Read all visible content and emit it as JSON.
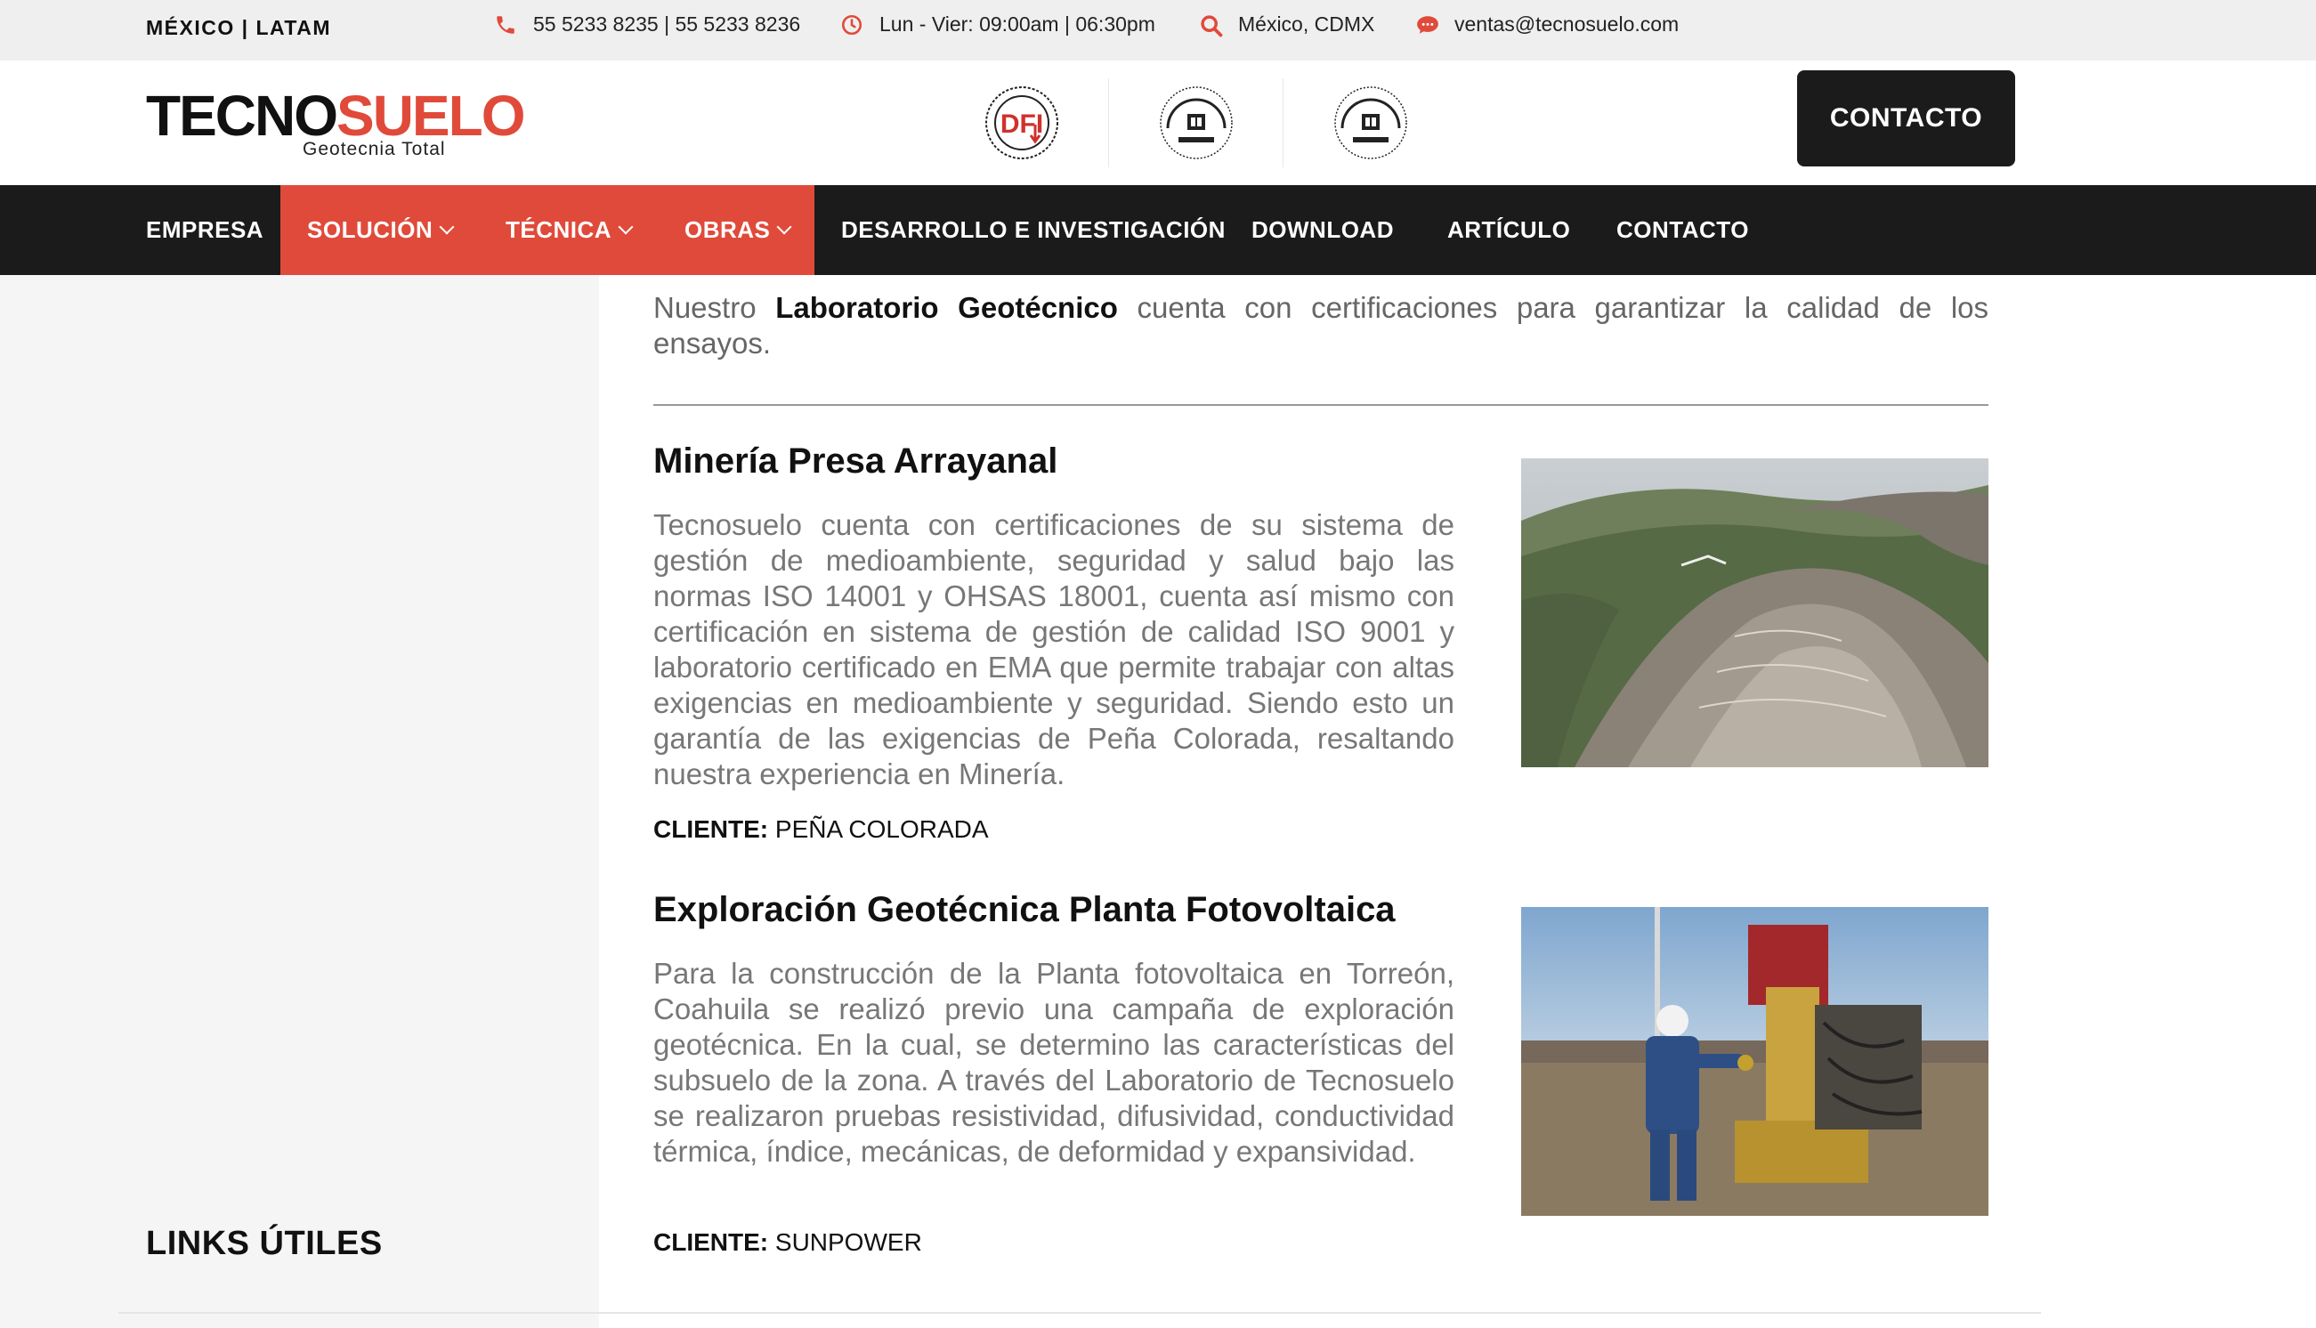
{
  "topbar": {
    "region": "MÉXICO | LATAM",
    "phone": "55 5233 8235 | 55 5233 8236",
    "hours": "Lun - Vier: 09:00am | 06:30pm",
    "location": "México, CDMX",
    "email": "ventas@tecnosuelo.com"
  },
  "header": {
    "logo_part1": "TECNO",
    "logo_part2": "SUELO",
    "logo_tagline": "Geotecnia Total",
    "contact_label": "CONTACTO",
    "cert1_text": "DFI"
  },
  "nav": {
    "items": [
      "EMPRESA",
      "SOLUCIÓN",
      "TÉCNICA",
      "OBRAS",
      "DESARROLLO E INVESTIGACIÓN",
      "DOWNLOAD",
      "ARTÍCULO",
      "CONTACTO"
    ]
  },
  "main": {
    "intro_pre": "Nuestro ",
    "intro_bold": "Laboratorio Geotécnico",
    "intro_post": " cuenta con certificaciones para garantizar la calidad de los ensayos.",
    "projects": [
      {
        "title": "Minería Presa Arrayanal",
        "text": "Tecnosuelo cuenta con certificaciones de su sistema de gestión de medioambiente, seguridad y salud bajo las normas ISO 14001 y OHSAS 18001, cuenta así mismo con certificación en sistema de gestión de calidad ISO 9001 y laboratorio certificado en EMA que permite trabajar con altas exigencias en medioambiente y seguridad. Siendo esto un garantía de las exigencias de Peña Colorada, resaltando nuestra experiencia en Minería.",
        "client_label": "CLIENTE:",
        "client": "PEÑA COLORADA"
      },
      {
        "title": "Exploración Geotécnica Planta Fotovoltaica",
        "text": "Para la construcción de la Planta fotovoltaica en Torreón, Coahuila se realizó previo una campaña de exploración geotécnica.  En la cual, se determino las características del subsuelo de la zona. A través del Laboratorio de Tecnosuelo se realizaron pruebas resistividad, difusividad, conductividad térmica, índice, mecánicas, de deformidad y expansividad.",
        "client_label": "CLIENTE:",
        "client": "SUNPOWER"
      }
    ]
  },
  "sidebar": {
    "links_title": "LINKS ÚTILES"
  },
  "colors": {
    "accent": "#e04a3a",
    "dark": "#1b1b1b"
  }
}
